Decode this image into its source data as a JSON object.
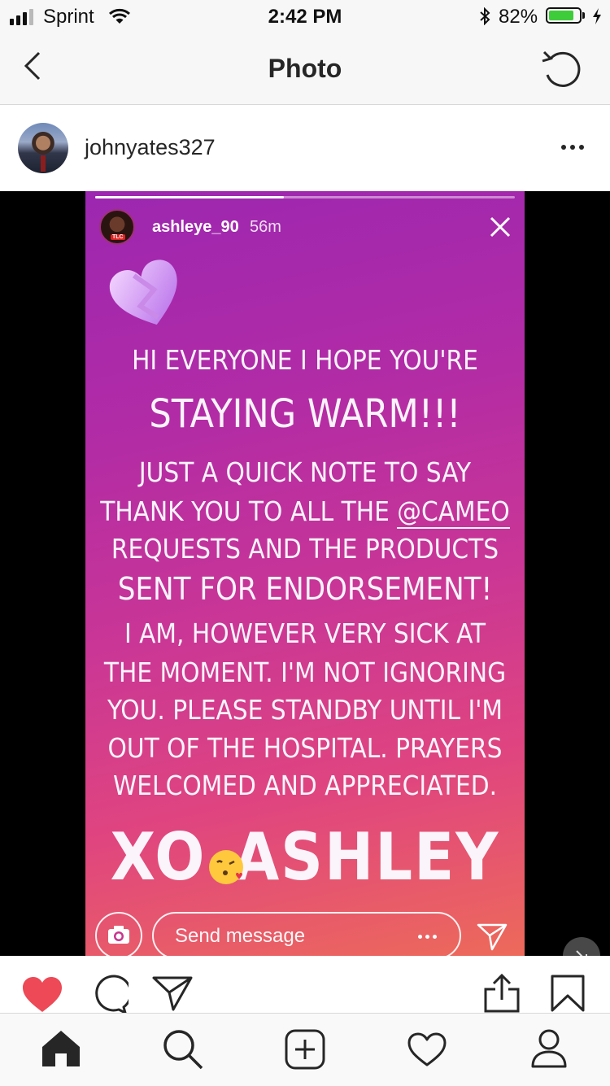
{
  "status_bar": {
    "carrier": "Sprint",
    "time": "2:42 PM",
    "battery_percent": "82%",
    "battery_level": 0.82
  },
  "header": {
    "title": "Photo",
    "back_icon": "chevron-left-icon",
    "refresh_icon": "refresh-icon"
  },
  "post": {
    "username": "johnyates327",
    "more_icon": "more-dots-icon"
  },
  "story": {
    "username": "ashleye_90",
    "age": "56m",
    "progress": 0.45,
    "lines": [
      "HI EVERYONE I HOPE YOU'RE",
      "STAYING WARM!!!",
      "JUST A QUICK NOTE TO SAY",
      "THANK YOU TO ALL THE ",
      "@CAMEO",
      "REQUESTS AND THE PRODUCTS",
      "SENT FOR ENDORSEMENT!",
      "I AM, HOWEVER VERY SICK AT",
      "THE MOMENT. I'M NOT IGNORING",
      "YOU. PLEASE STANDBY UNTIL I'M",
      "OUT OF THE HOSPITAL. PRAYERS",
      "WELCOMED AND APPRECIATED.",
      "XO",
      "ASHLEY"
    ],
    "send_placeholder": "Send message",
    "avatar_badge": "TLC"
  },
  "colors": {
    "like_red": "#ed4956",
    "text_dark": "#262626",
    "story_purple": "#9c27b0",
    "story_pink": "#e0457f"
  }
}
